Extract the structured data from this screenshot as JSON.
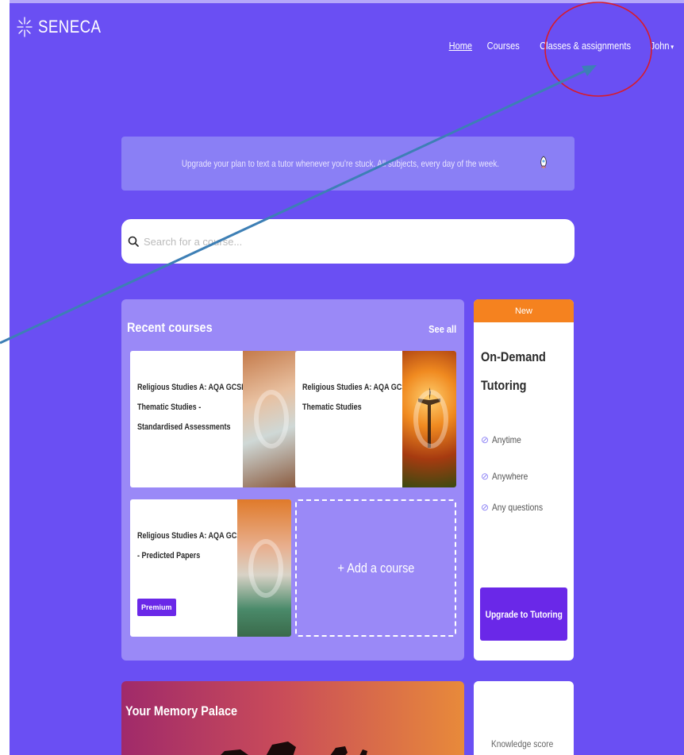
{
  "header": {
    "logo_text": "SENECA",
    "nav": {
      "home": "Home",
      "courses": "Courses",
      "classes": "Classes & assignments",
      "user": "John",
      "caret": "▾"
    }
  },
  "banner": {
    "text": "Upgrade your plan to text a tutor whenever you're stuck. All subjects, every day of the week.",
    "icon": "rocket-icon"
  },
  "search": {
    "placeholder": "Search for a course..."
  },
  "recent": {
    "title": "Recent courses",
    "see_all": "See all",
    "courses": [
      {
        "lines": [
          "Religious Studies A: AQA GCSE",
          "Thematic Studies -",
          "Standardised Assessments"
        ]
      },
      {
        "lines": [
          "Religious Studies A: AQA GCSE",
          "Thematic Studies"
        ]
      },
      {
        "lines": [
          "Religious Studies A: AQA GCSE",
          "- Predicted Papers"
        ],
        "badge": "Premium"
      }
    ],
    "add_course": "+ Add a course"
  },
  "tutoring": {
    "badge": "New",
    "title_lines": [
      "On-Demand",
      "Tutoring"
    ],
    "features": [
      "Anytime",
      "Anywhere",
      "Any questions"
    ],
    "button": "Upgrade to Tutoring"
  },
  "memory_palace": {
    "title": "Your Memory Palace"
  },
  "knowledge": {
    "label": "Knowledge score"
  },
  "colors": {
    "background": "#6a4ff3",
    "accent_orange": "#f5821f",
    "button_purple": "#6a28e8",
    "annotation_red": "#d81b2a",
    "annotation_blue": "#3d7fb5"
  }
}
